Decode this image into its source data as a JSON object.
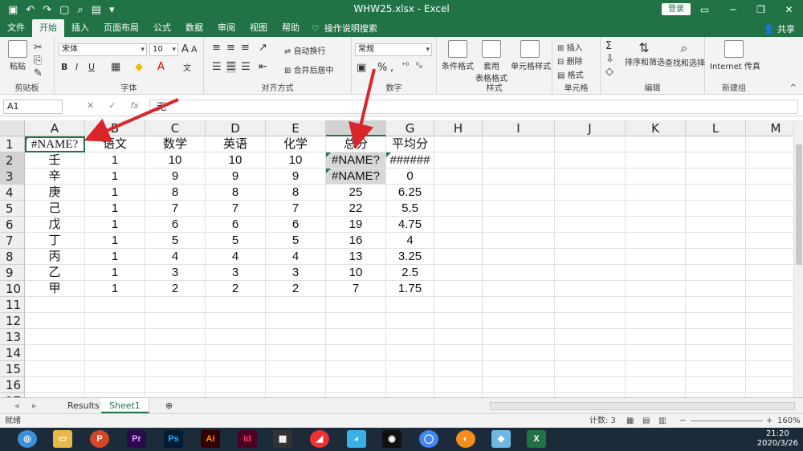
{
  "window": {
    "title": "WHW25.xlsx - Excel",
    "login_label": "登录",
    "qat_icons": [
      "save-icon",
      "undo-icon",
      "redo-icon",
      "new-file-icon",
      "print-preview-icon",
      "open-icon",
      "customize-icon"
    ]
  },
  "ribbon_tabs": [
    {
      "label": "文件",
      "active": false
    },
    {
      "label": "开始",
      "active": true
    },
    {
      "label": "插入",
      "active": false
    },
    {
      "label": "页面布局",
      "active": false
    },
    {
      "label": "公式",
      "active": false
    },
    {
      "label": "数据",
      "active": false
    },
    {
      "label": "审阅",
      "active": false
    },
    {
      "label": "视图",
      "active": false
    },
    {
      "label": "帮助",
      "active": false
    }
  ],
  "tell_me": "操作说明搜索",
  "share": "共享",
  "ribbon": {
    "clipboard": {
      "label": "剪贴板",
      "paste": "粘贴"
    },
    "font": {
      "label": "字体",
      "name": "宋体",
      "size": "10"
    },
    "alignment": {
      "label": "对齐方式",
      "wrap": "自动换行",
      "merge": "合并后居中"
    },
    "number": {
      "label": "数字",
      "format": "常规"
    },
    "styles": {
      "label": "样式",
      "conditional": "条件格式",
      "table": "套用",
      "table2": "表格格式",
      "cell": "单元格样式"
    },
    "cells": {
      "label": "单元格",
      "insert": "插入",
      "delete": "删除",
      "format": "格式"
    },
    "editing": {
      "label": "编辑",
      "sort": "排序和筛选",
      "find": "查找和选择"
    },
    "new_group": {
      "label": "新建组",
      "print": "Internet 传真"
    }
  },
  "formula_bar": {
    "name_box": "A1",
    "content": "无"
  },
  "columns": [
    "A",
    "B",
    "C",
    "D",
    "E",
    "F",
    "G",
    "H",
    "I",
    "J",
    "K",
    "L",
    "M"
  ],
  "rows": [
    [
      "#NAME?",
      "语文",
      "数学",
      "英语",
      "化学",
      "总分",
      "平均分"
    ],
    [
      "壬",
      "1",
      "10",
      "10",
      "10",
      "#NAME?",
      "######"
    ],
    [
      "辛",
      "1",
      "9",
      "9",
      "9",
      "#NAME?",
      "0"
    ],
    [
      "庚",
      "1",
      "8",
      "8",
      "8",
      "25",
      "6.25"
    ],
    [
      "己",
      "1",
      "7",
      "7",
      "7",
      "22",
      "5.5"
    ],
    [
      "戊",
      "1",
      "6",
      "6",
      "6",
      "19",
      "4.75"
    ],
    [
      "丁",
      "1",
      "5",
      "5",
      "5",
      "16",
      "4"
    ],
    [
      "丙",
      "1",
      "4",
      "4",
      "4",
      "13",
      "3.25"
    ],
    [
      "乙",
      "1",
      "3",
      "3",
      "3",
      "10",
      "2.5"
    ],
    [
      "甲",
      "1",
      "2",
      "2",
      "2",
      "7",
      "1.75"
    ],
    [
      "",
      "",
      "",
      "",
      "",
      "",
      ""
    ],
    [
      "",
      "",
      "",
      "",
      "",
      "",
      ""
    ],
    [
      "",
      "",
      "",
      "",
      "",
      "",
      ""
    ],
    [
      "",
      "",
      "",
      "",
      "",
      "",
      ""
    ],
    [
      "",
      "",
      "",
      "",
      "",
      "",
      ""
    ],
    [
      "",
      "",
      "",
      "",
      "",
      "",
      ""
    ],
    [
      "",
      "",
      "",
      "",
      "",
      "",
      ""
    ]
  ],
  "sheets": [
    {
      "name": "Results",
      "active": false
    },
    {
      "name": "Sheet1",
      "active": true
    }
  ],
  "status": {
    "mode": "就绪",
    "count": "计数: 3",
    "zoom": "160%"
  },
  "taskbar": {
    "time": "21:20",
    "date": "2020/3/26",
    "apps": [
      "Pr",
      "Ps",
      "Ai",
      "Id"
    ]
  },
  "colors": {
    "accent": "#217346",
    "arrow": "#d9262b",
    "error_fill": "#d8d8d8"
  }
}
